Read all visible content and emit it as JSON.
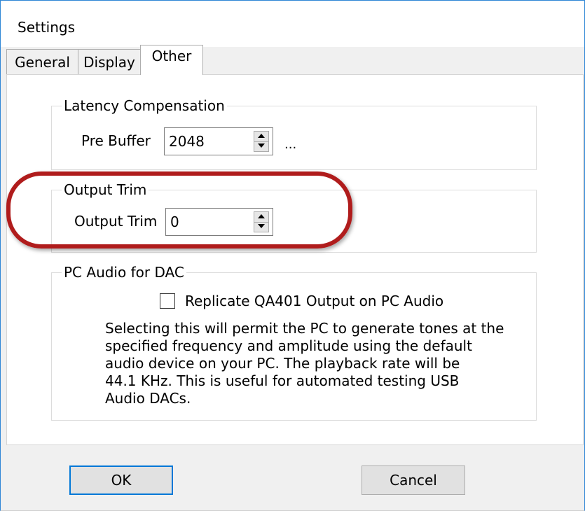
{
  "window": {
    "title": "Settings"
  },
  "tabs": [
    {
      "label": "General",
      "active": false
    },
    {
      "label": "Display",
      "active": false
    },
    {
      "label": "Other",
      "active": true
    }
  ],
  "latency": {
    "group_label": "Latency Compensation",
    "pre_buffer_label": "Pre Buffer",
    "pre_buffer_value": "2048",
    "ellipsis": "..."
  },
  "output_trim": {
    "group_label": "Output Trim",
    "field_label": "Output Trim",
    "value": "0"
  },
  "pc_audio": {
    "group_label": "PC Audio for DAC",
    "checkbox_label": "Replicate QA401 Output on PC Audio",
    "checked": false,
    "description": "Selecting this will permit the PC to generate tones at the\nspecified frequency and amplitude using the default\naudio device on your PC. The playback rate will be\n44.1 KHz. This is useful for automated testing USB\nAudio DACs."
  },
  "buttons": {
    "ok_label": "OK",
    "cancel_label": "Cancel"
  },
  "colors": {
    "highlight": "#b01c1c",
    "default_button_border": "#0078d7"
  },
  "icons": {
    "spin_up": "chevron-up-icon",
    "spin_down": "chevron-down-icon"
  }
}
